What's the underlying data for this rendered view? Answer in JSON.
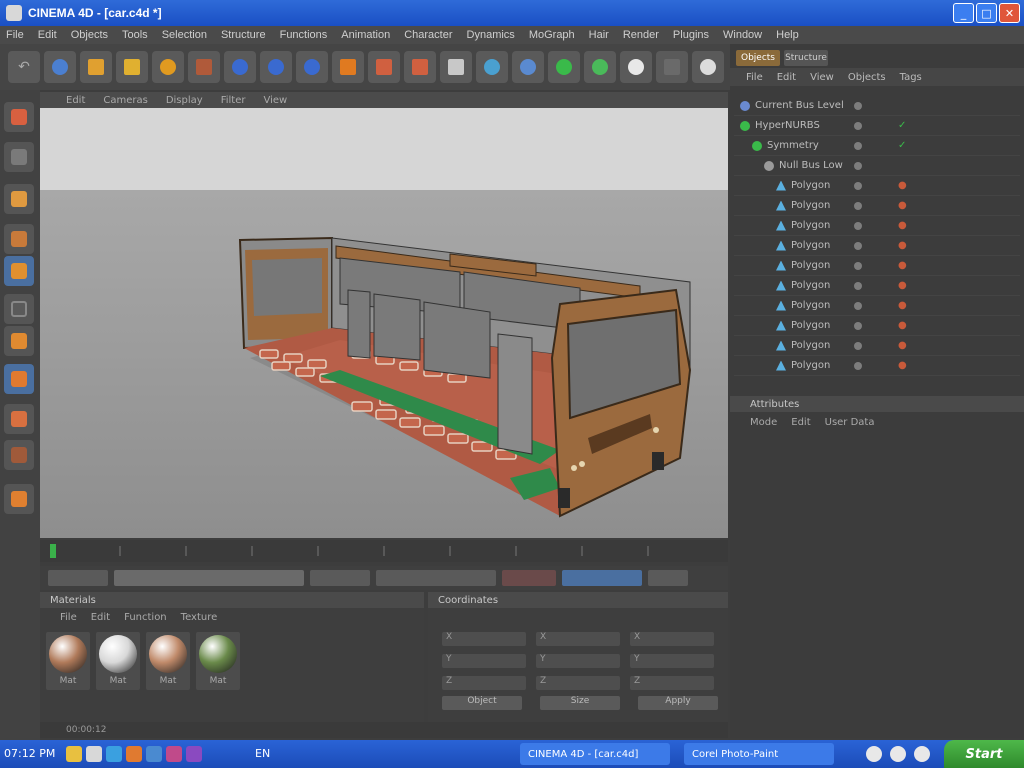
{
  "window": {
    "title": "CINEMA 4D - [car.c4d *]",
    "buttons": {
      "close": "✕",
      "maximize": "□",
      "minimize": "_"
    }
  },
  "menu": [
    "File",
    "Edit",
    "Objects",
    "Tools",
    "Selection",
    "Structure",
    "Functions",
    "Animation",
    "Character",
    "Dynamics",
    "MoGraph",
    "Hair",
    "Render",
    "Plugins",
    "Window",
    "Help"
  ],
  "viewport": {
    "menu": [
      "Edit",
      "Cameras",
      "Display",
      "Filter",
      "View"
    ]
  },
  "right_panel": {
    "tabs": [
      "Objects",
      "Structure"
    ],
    "menu": [
      "File",
      "Edit",
      "View",
      "Objects",
      "Tags"
    ],
    "objects": [
      {
        "name": "Current Bus Level",
        "indent": 0,
        "icon": "layer-icon",
        "check": ""
      },
      {
        "name": "HyperNURBS",
        "indent": 0,
        "icon": "nurbs-icon",
        "check": "✓"
      },
      {
        "name": "Symmetry",
        "indent": 1,
        "icon": "symmetry-icon",
        "check": "✓"
      },
      {
        "name": "Null Bus Low",
        "indent": 2,
        "icon": "null-icon",
        "check": ""
      },
      {
        "name": "Polygon",
        "indent": 3,
        "icon": "polygon-icon",
        "check": "●"
      },
      {
        "name": "Polygon",
        "indent": 3,
        "icon": "polygon-icon",
        "check": "●"
      },
      {
        "name": "Polygon",
        "indent": 3,
        "icon": "polygon-icon",
        "check": "●"
      },
      {
        "name": "Polygon",
        "indent": 3,
        "icon": "polygon-icon",
        "check": "●"
      },
      {
        "name": "Polygon",
        "indent": 3,
        "icon": "polygon-icon",
        "check": "●"
      },
      {
        "name": "Polygon",
        "indent": 3,
        "icon": "polygon-icon",
        "check": "●"
      },
      {
        "name": "Polygon",
        "indent": 3,
        "icon": "polygon-icon",
        "check": "●"
      },
      {
        "name": "Polygon",
        "indent": 3,
        "icon": "polygon-icon",
        "check": "●"
      },
      {
        "name": "Polygon",
        "indent": 3,
        "icon": "polygon-icon",
        "check": "●"
      },
      {
        "name": "Polygon",
        "indent": 3,
        "icon": "polygon-icon",
        "check": "●"
      }
    ],
    "attributes_title": "Attributes",
    "attributes_menu": [
      "Mode",
      "Edit",
      "User Data"
    ]
  },
  "materials": {
    "title": "Materials",
    "menu": [
      "File",
      "Edit",
      "Function",
      "Texture"
    ],
    "items": [
      {
        "label": "Mat",
        "color": "#b07a5a"
      },
      {
        "label": "Mat",
        "color": "#d8d8d8"
      },
      {
        "label": "Mat",
        "color": "#c08a6a"
      },
      {
        "label": "Mat",
        "color": "#6a8a4a"
      }
    ]
  },
  "coordinates": {
    "title": "Coordinates",
    "labels": [
      "X",
      "Y",
      "Z"
    ],
    "buttons": [
      "Object",
      "Size",
      "Apply"
    ]
  },
  "status": {
    "text": "00:00:12"
  },
  "taskbar": {
    "clock": "07:12 PM",
    "lang": "EN",
    "tasks": [
      {
        "label": "CINEMA 4D - [car.c4d]"
      },
      {
        "label": "Corel Photo-Paint"
      }
    ],
    "start": "Start"
  },
  "colors": {
    "accent": "#2f6bd8",
    "viewport_sky": "#d4d4d4",
    "viewport_floor": "#9a9a9a",
    "bus_body": "#9b6a3e",
    "bus_glass": "#6f6f6f",
    "seat": "#c2664b",
    "floor_strip": "#2f8a4a"
  }
}
